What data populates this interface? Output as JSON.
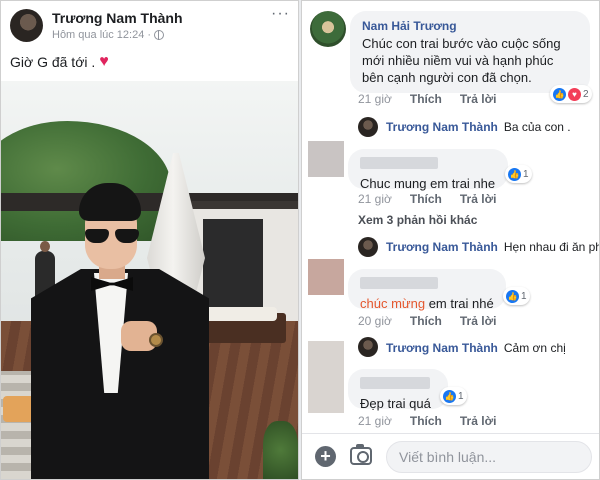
{
  "post": {
    "author": "Trương Nam Thành",
    "time": "Hôm qua lúc 12:24 · ",
    "more": "···",
    "caption": "Giờ G đã tới ."
  },
  "comments": [
    {
      "author": "Nam Hải Trương",
      "text": "Chúc con trai bước vào cuộc sống mới nhiều niềm vui và hạnh phúc bên cạnh người con đã chọn.",
      "time": "21 giờ",
      "like": "Thích",
      "reply": "Trả lời",
      "reaction_count": "2",
      "replies": [
        {
          "author": "Trương Nam Thành",
          "text": "Ba của con ."
        }
      ]
    },
    {
      "text": "Chuc mung em trai nhe",
      "time": "21 giờ",
      "like": "Thích",
      "reply": "Trả lời",
      "reaction_count": "1",
      "more_replies": "Xem 3 phản hồi khác",
      "replies": [
        {
          "author": "Trương Nam Thành",
          "text": "Hẹn nhau đi ăn ph..."
        }
      ]
    },
    {
      "text_highlight": "chúc mừng",
      "text": " em trai nhé",
      "time": "20 giờ",
      "like": "Thích",
      "reply": "Trả lời",
      "reaction_count": "1",
      "replies": [
        {
          "author": "Trương Nam Thành",
          "text": "Cảm ơn chị"
        }
      ]
    },
    {
      "text": "Đẹp trai quá",
      "time": "21 giờ",
      "like": "Thích",
      "reply": "Trả lời",
      "reaction_count": "1"
    }
  ],
  "composer": {
    "placeholder": "Viết bình luận..."
  },
  "icons": {
    "like": "thumbs-up-icon",
    "love": "heart-icon",
    "add": "plus-icon",
    "camera": "camera-icon",
    "privacy": "globe-icon"
  },
  "colors": {
    "link": "#385898",
    "like_blue": "#1877f2",
    "love_red": "#f33e58",
    "highlight_orange": "#e4572e"
  }
}
